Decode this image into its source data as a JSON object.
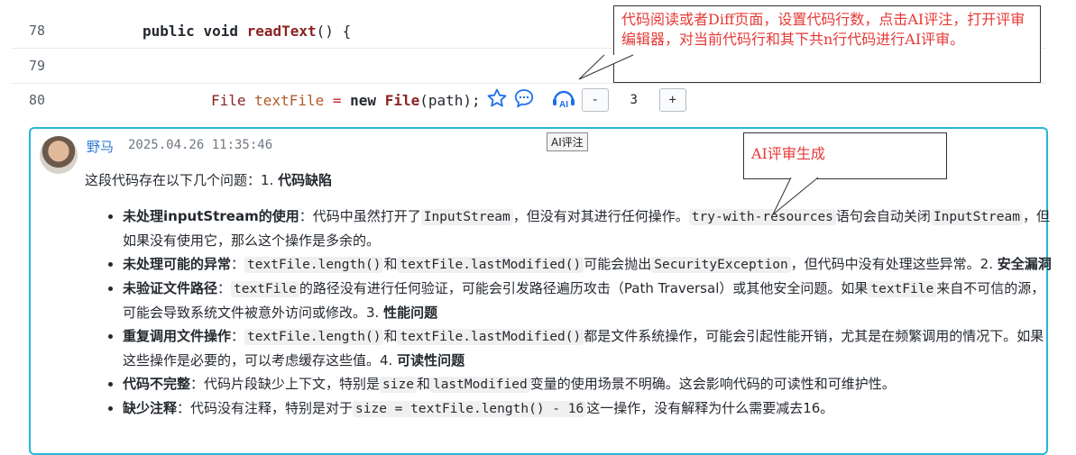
{
  "code": {
    "lines": [
      {
        "num": "78",
        "parts": [
          "public",
          "void",
          "readText",
          "() {"
        ]
      },
      {
        "num": "79"
      },
      {
        "num": "80",
        "parts": [
          "File",
          "textFile",
          "=",
          "new",
          "File",
          "(path);"
        ]
      }
    ]
  },
  "toolbar": {
    "star_icon": "star-icon",
    "comment_icon": "comment-bubble-icon",
    "ai_icon": "ai-review-icon",
    "minus": "-",
    "count": "3",
    "plus": "+",
    "tooltip": "AI评注"
  },
  "callouts": {
    "top": "代码阅读或者Diff页面，设置代码行数，点击AI评注，打开评审编辑器，对当前代码行和其下共n行代码进行AI评审。",
    "mid": "AI评审生成"
  },
  "review": {
    "author": "野马",
    "timestamp": "2025.04.26 11:35:46",
    "intro": {
      "text": "这段代码存在以下几个问题：1.",
      "heading": "代码缺陷"
    },
    "items": [
      {
        "title": "未处理inputStream的使用",
        "t1": "：代码中虽然打开了",
        "c1": "InputStream",
        "t2": "，但没有对其进行任何操作。",
        "c2": "try-with-resources",
        "t3": "语句会自动关闭",
        "c3": "InputStream",
        "t4": "，但如果没有使用它，那么这个操作是多余的。"
      },
      {
        "title": "未处理可能的异常",
        "t1": "：",
        "c1": "textFile.length()",
        "t2": "和",
        "c2": "textFile.lastModified()",
        "t3": "可能会抛出",
        "c3": "SecurityException",
        "t4": "，但代码中没有处理这些异常。2.",
        "h": "安全漏洞"
      },
      {
        "title": "未验证文件路径",
        "t1": "：",
        "c1": "textFile",
        "t2": "的路径没有进行任何验证，可能会引发路径遍历攻击（Path Traversal）或其他安全问题。如果",
        "c2": "textFile",
        "t3": "来自不可信的源，可能会导致系统文件被意外访问或修改。3.",
        "h": "性能问题"
      },
      {
        "title": "重复调用文件操作",
        "t1": "：",
        "c1": "textFile.length()",
        "t2": "和",
        "c2": "textFile.lastModified()",
        "t3": "都是文件系统操作，可能会引起性能开销，尤其是在频繁调用的情况下。如果这些操作是必要的，可以考虑缓存这些值。4.",
        "h": "可读性问题"
      },
      {
        "title": "代码不完整",
        "t1": "：代码片段缺少上下文，特别是",
        "c1": "size",
        "t2": "和",
        "c2": "lastModified",
        "t3": "变量的使用场景不明确。这会影响代码的可读性和可维护性。"
      },
      {
        "title": "缺少注释",
        "t1": "：代码没有注释，特别是对于",
        "c1": "size = textFile.length() - 16",
        "t2": "这一操作，没有解释为什么需要减去16。"
      }
    ]
  }
}
